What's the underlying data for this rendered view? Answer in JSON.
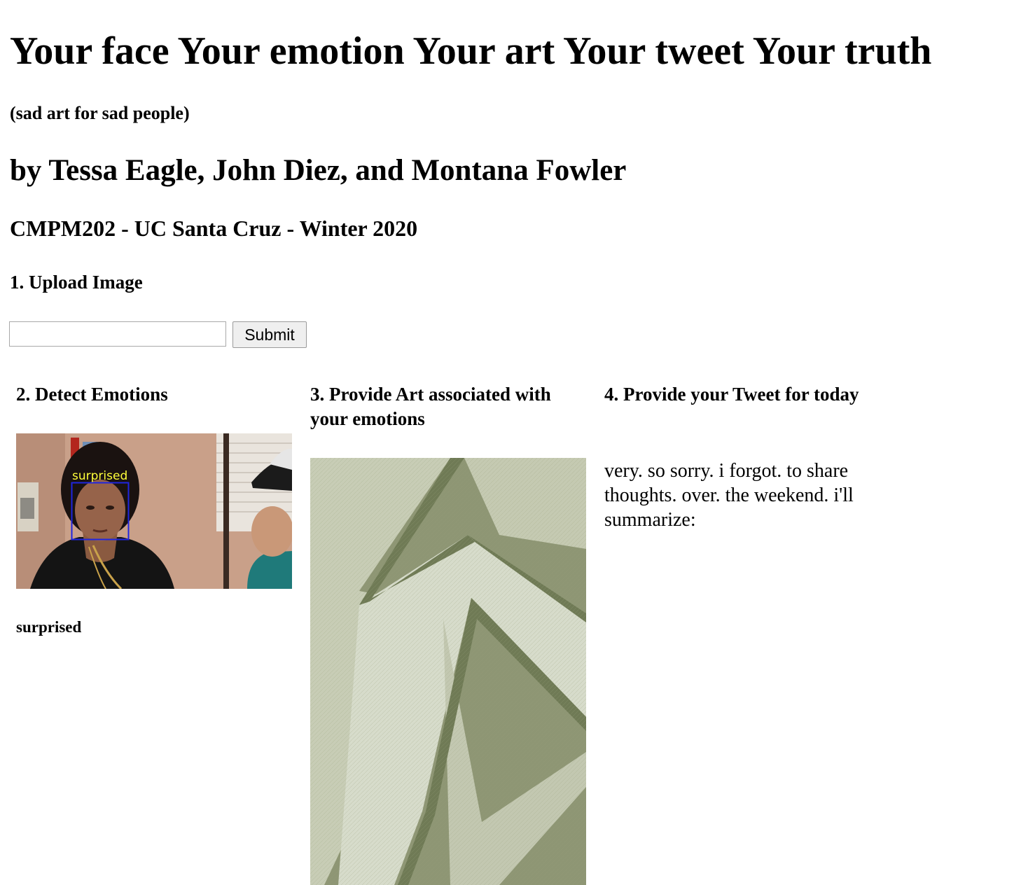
{
  "header": {
    "title": "Your face Your emotion Your art Your tweet Your truth",
    "subtitle": "(sad art for sad people)",
    "authors": "by Tessa Eagle, John Diez, and Montana Fowler",
    "course": "CMPM202 - UC Santa Cruz - Winter 2020"
  },
  "upload": {
    "heading": "1. Upload Image",
    "input_value": "",
    "submit_label": "Submit"
  },
  "detect": {
    "heading": "2. Detect Emotions",
    "image_box_label": "surprised",
    "emotion_result": "surprised"
  },
  "art": {
    "heading": "3. Provide Art associated with your emotions"
  },
  "tweet": {
    "heading": "4. Provide your Tweet for today",
    "text": "very. so sorry. i forgot. to share thoughts. over. the weekend. i'll summarize:"
  }
}
